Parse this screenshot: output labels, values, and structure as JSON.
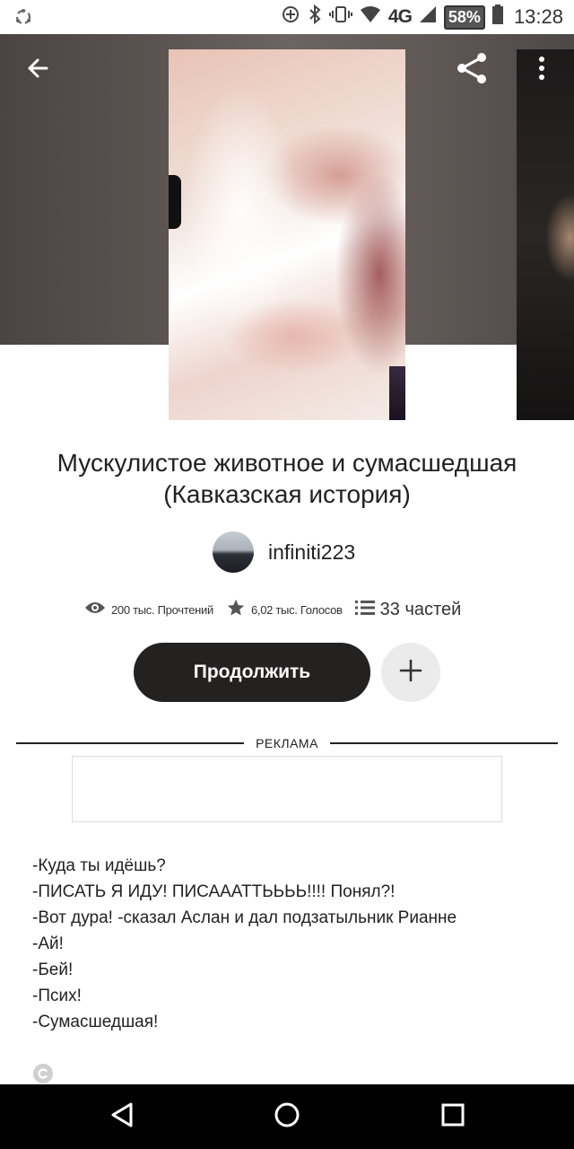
{
  "status_bar": {
    "network": "4G",
    "battery": "58%",
    "time": "13:28"
  },
  "hero": {
    "back_icon": "arrow-left-icon",
    "share_icon": "share-icon",
    "more_icon": "more-vertical-icon"
  },
  "book": {
    "title_line1": "Мускулистое животное и сумасшедшая",
    "title_line2": "(Кавказская история)",
    "author": "infiniti223",
    "reads": "200 тыс. Прочтений",
    "votes": "6,02 тыс. Голосов",
    "parts": "33 частей"
  },
  "actions": {
    "continue_label": "Продолжить",
    "add_icon": "plus-icon"
  },
  "ad": {
    "label": "РЕКЛАМА"
  },
  "story": {
    "lines": [
      "-Куда ты идёшь?",
      "-ПИСАТЬ Я ИДУ! ПИСАААТТЬЬЬЬ!!!! Понял?!",
      "-Вот дура! -сказал Аслан и дал подзатыльник Рианне",
      "-Ай!",
      "-Бей!",
      "-Псих!",
      "-Сумасшедшая!"
    ]
  },
  "nav_bar": {
    "back_icon": "nav-back-icon",
    "home_icon": "nav-home-icon",
    "recents_icon": "nav-recents-icon"
  }
}
